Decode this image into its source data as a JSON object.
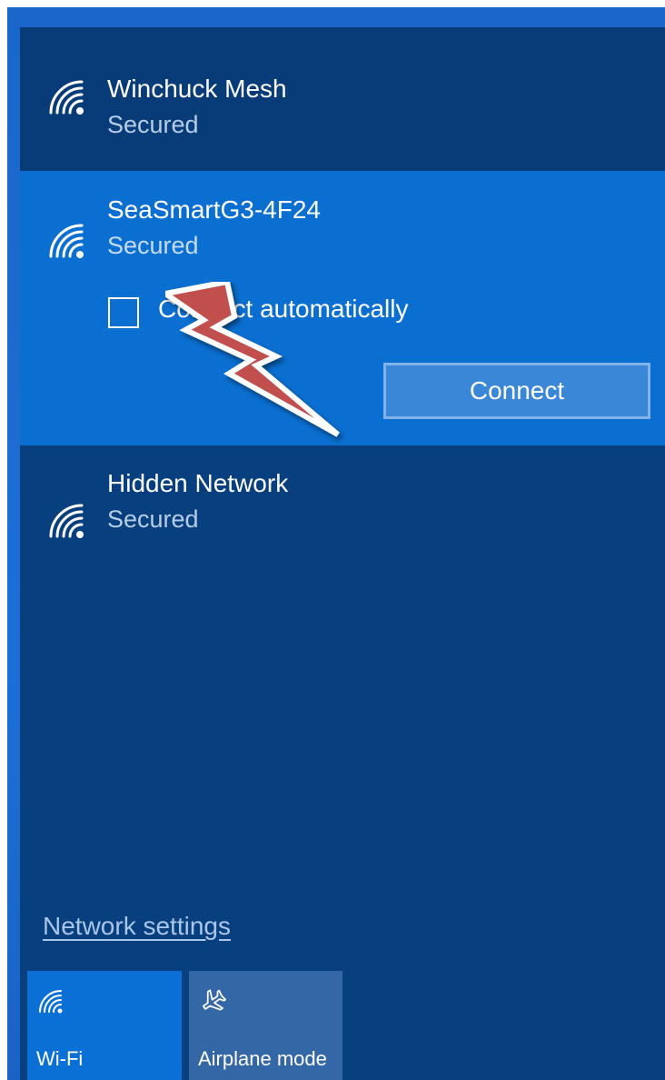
{
  "networks": [
    {
      "name": "Winchuck Mesh",
      "status": "Secured",
      "icon": "wifi-signal-icon"
    },
    {
      "name": "SeaSmartG3-4F24",
      "status": "Secured",
      "icon": "wifi-signal-icon",
      "connect_automatically": {
        "label": "Connect automatically",
        "checked": false
      },
      "connect_label": "Connect"
    },
    {
      "name": "Hidden Network",
      "status": "Secured",
      "icon": "wifi-signal-icon"
    }
  ],
  "network_settings_label": "Network settings",
  "quick_actions": [
    {
      "label": "Wi-Fi",
      "icon": "wifi-icon",
      "active": true
    },
    {
      "label": "Airplane mode",
      "icon": "airplane-icon",
      "active": false
    }
  ],
  "annotation": {
    "icon": "lightning-bolt-icon",
    "color": "#c0504d"
  },
  "colors": {
    "panel_bg": "#083f7e",
    "selected_bg": "#0a6fd0",
    "accent": "#0b70d6"
  }
}
